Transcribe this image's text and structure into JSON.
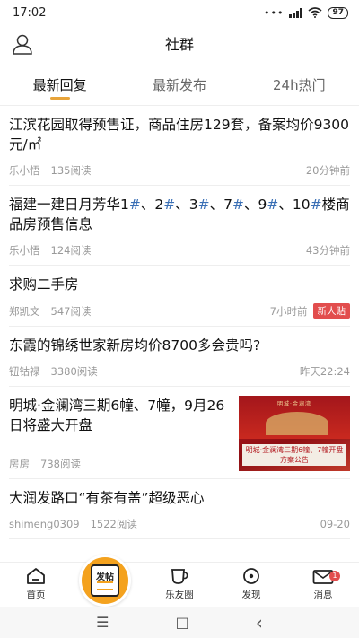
{
  "status_bar": {
    "time": "17:02",
    "dots": "•••",
    "battery": "97"
  },
  "header": {
    "title": "社群",
    "profile_icon": "person-icon"
  },
  "tabs": [
    {
      "label": "最新回复",
      "active": true
    },
    {
      "label": "最新发布",
      "active": false
    },
    {
      "label": "24h热门",
      "active": false
    }
  ],
  "posts": [
    {
      "title": "江滨花园取得预售证，商品住房129套，备案均价9300元/㎡",
      "author": "乐小悟",
      "views": "135阅读",
      "time": "20分钟前"
    },
    {
      "title_parts": [
        "福建一建日月芳华1",
        "#",
        "、2",
        "#",
        "、3",
        "#",
        "、7",
        "#",
        "、9",
        "#",
        "、10",
        "#",
        "楼商品房预售信息"
      ],
      "author": "乐小悟",
      "views": "124阅读",
      "time": "43分钟前"
    },
    {
      "title": "求购二手房",
      "author": "郑凯文",
      "views": "547阅读",
      "time": "7小时前",
      "badge": "新人贴"
    },
    {
      "title": "东霞的锦绣世家新房均价8700多会贵吗?",
      "author": "钮钴禄",
      "views": "3380阅读",
      "time": "昨天22:24"
    },
    {
      "title": "明城·金澜湾三期6幢、7幢，9月26日将盛大开盘",
      "author": "房房",
      "views": "738阅读",
      "time": "",
      "image_caption": "明城·金澜湾三期6幢、7幢开盘方案公告",
      "image_logo": "明城·金澜湾"
    },
    {
      "title": "大润发路口“有茶有盖”超级恶心",
      "author": "shimeng0309",
      "views": "1522阅读",
      "time": "09-20"
    }
  ],
  "bottom_nav": {
    "home": {
      "label": "首页",
      "icon": "home-icon"
    },
    "post": {
      "label": "发帖",
      "icon": "post-card-icon"
    },
    "friends": {
      "label": "乐友圈",
      "icon": "cup-icon"
    },
    "discover": {
      "label": "发现",
      "icon": "compass-icon"
    },
    "messages": {
      "label": "消息",
      "icon": "mail-icon",
      "badge": "1"
    }
  },
  "system_nav": {
    "menu": "☰",
    "home": "□",
    "back": "‹"
  },
  "colors": {
    "accent": "#e8a43a",
    "fab": "#f4a21e",
    "badge": "#e24d4d",
    "hashtag": "#3a6fb5"
  }
}
